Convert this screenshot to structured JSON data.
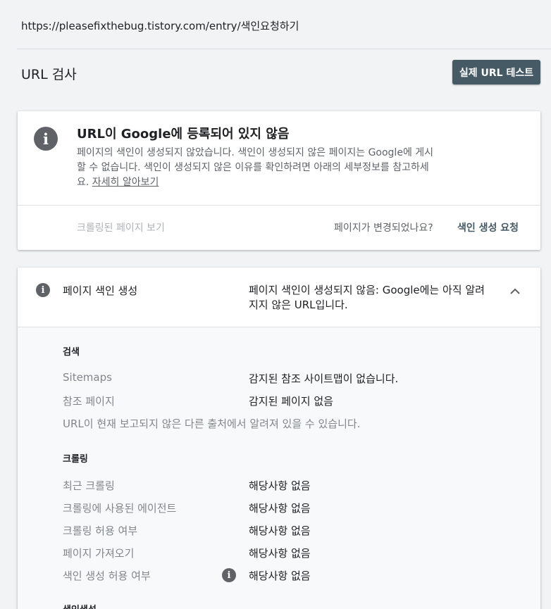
{
  "url": "https://pleasefixthebug.tistory.com/entry/색인요청하기",
  "page_title": "URL 검사",
  "live_test_label": "실제 URL 테스트",
  "status_card": {
    "title": "URL이 Google에 등록되어 있지 않음",
    "desc_line1": "페이지의 색인이 생성되지 않았습니다. 색인이 생성되지 않은 페이지는 Google에 게시",
    "desc_line2": "할 수 없습니다. 색인이 생성되지 않은 이유를 확인하려면 아래의 세부정보를 참고하세",
    "desc_line3_prefix": "요.",
    "learn_more": "자세히 알아보기",
    "crawled_page_link": "크롤링된 페이지 보기",
    "changed_question": "페이지가 변경되었나요?",
    "request_indexing": "색인 생성 요청"
  },
  "coverage": {
    "label": "페이지 색인 생성",
    "value_line1": "페이지 색인이 생성되지 않음: Google에는 아직 알려",
    "value_line2": "지지 않은 URL입니다.",
    "discovery": {
      "title": "검색",
      "sitemaps_k": "Sitemaps",
      "sitemaps_v": "감지된 참조 사이트맵이 없습니다.",
      "referring_k": "참조 페이지",
      "referring_v": "감지된 페이지 없음",
      "note": "URL이 현재 보고되지 않은 다른 출처에서 알려져 있을 수 있습니다."
    },
    "crawl": {
      "title": "크롤링",
      "rows": [
        {
          "k": "최근 크롤링",
          "v": "해당사항 없음"
        },
        {
          "k": "크롤링에 사용된 에이전트",
          "v": "해당사항 없음"
        },
        {
          "k": "크롤링 허용 여부",
          "v": "해당사항 없음"
        },
        {
          "k": "페이지 가져오기",
          "v": "해당사항 없음"
        },
        {
          "k": "색인 생성 허용 여부",
          "v": "해당사항 없음"
        }
      ]
    },
    "indexing": {
      "title": "색인생성"
    }
  }
}
